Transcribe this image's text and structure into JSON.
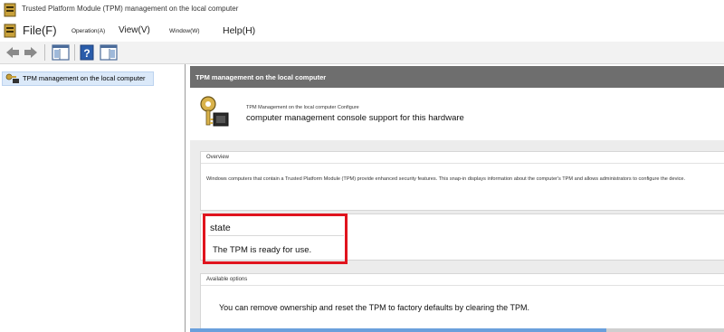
{
  "window": {
    "title": "Trusted Platform Module (TPM) management on the local computer",
    "app_icon": "tpm-console-icon"
  },
  "menubar": {
    "items": [
      {
        "label": "File(F)"
      },
      {
        "label": "Operation(A)"
      },
      {
        "label": "View(V)"
      },
      {
        "label": "Window(W)"
      },
      {
        "label": "Help(H)"
      }
    ]
  },
  "toolbar": {
    "buttons": [
      "back-arrow-icon",
      "forward-arrow-icon",
      "show-hide-tree-icon",
      "help-icon",
      "action-pane-icon"
    ]
  },
  "tree": {
    "selected_label": "TPM management on the local computer"
  },
  "main": {
    "header": "TPM management on the local computer",
    "banner_small": "TPM Management on the local computer Configure",
    "banner_big": "computer management console support for this hardware",
    "overview": {
      "title": "Overview",
      "text": "Windows computers that contain a Trusted Platform Module (TPM) provide enhanced security features. This snap-in displays information about the computer's TPM and allows administrators to configure the device."
    },
    "state": {
      "title": "state",
      "text": "The TPM is ready for use."
    },
    "options": {
      "title": "Available options",
      "text": "You can remove ownership and reset the TPM to factory defaults by clearing the TPM."
    }
  },
  "colors": {
    "highlight_box": "#e0141e",
    "selected_tree_bg": "#dbe9f9",
    "header_bg": "#6e6e6e"
  }
}
